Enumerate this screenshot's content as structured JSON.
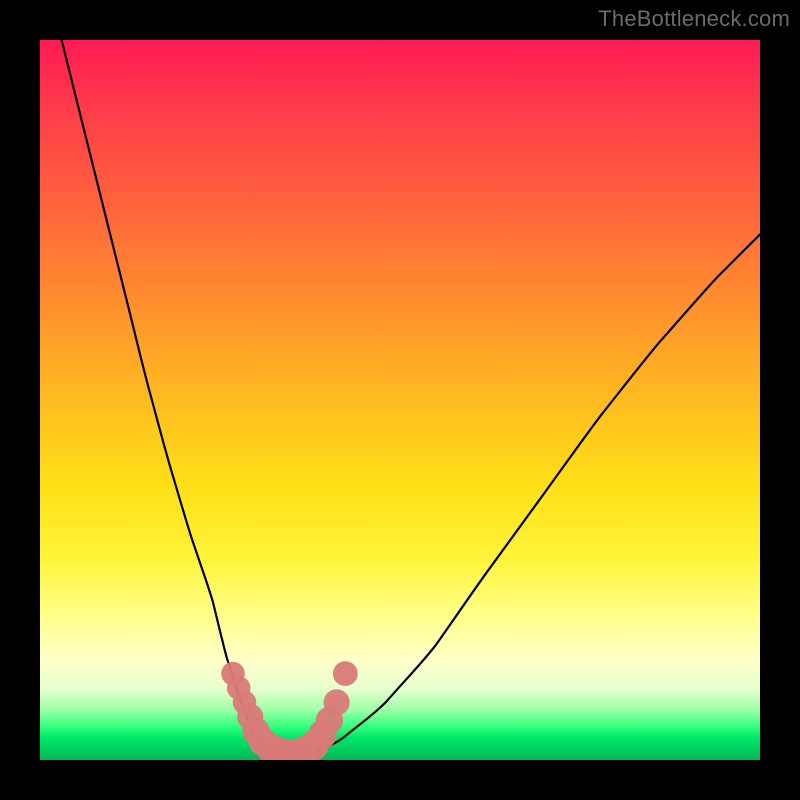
{
  "watermark": "TheBottleneck.com",
  "colors": {
    "frame": "#000000",
    "curve": "#000000",
    "marker": "#d97a78",
    "gradient_top": "#ff1a53",
    "gradient_mid": "#ffe018",
    "gradient_bottom": "#00b955"
  },
  "chart_data": {
    "type": "line",
    "title": "",
    "xlabel": "",
    "ylabel": "",
    "xlim": [
      0,
      100
    ],
    "ylim": [
      0,
      100
    ],
    "grid": false,
    "legend": false,
    "series": [
      {
        "name": "bottleneck-curve",
        "x": [
          3,
          6,
          9,
          12,
          15,
          18,
          21,
          24,
          26,
          28,
          29.5,
          31,
          33,
          35,
          38,
          42,
          48,
          55,
          62,
          70,
          78,
          86,
          94,
          100
        ],
        "y": [
          100,
          88,
          76,
          64,
          52,
          41,
          31,
          22,
          14,
          8,
          4,
          2,
          1,
          0.5,
          1,
          3,
          8,
          16,
          26,
          37,
          48,
          58,
          67,
          73
        ]
      }
    ],
    "markers": [
      {
        "x": 26.8,
        "y": 12,
        "r": 1.2
      },
      {
        "x": 27.6,
        "y": 10,
        "r": 1.2
      },
      {
        "x": 28.4,
        "y": 8,
        "r": 1.2
      },
      {
        "x": 29.2,
        "y": 6,
        "r": 1.4
      },
      {
        "x": 30.0,
        "y": 4,
        "r": 1.5
      },
      {
        "x": 31.0,
        "y": 2.5,
        "r": 1.6
      },
      {
        "x": 32.2,
        "y": 1.5,
        "r": 1.7
      },
      {
        "x": 33.5,
        "y": 1.0,
        "r": 1.7
      },
      {
        "x": 35.0,
        "y": 0.8,
        "r": 1.7
      },
      {
        "x": 36.5,
        "y": 1.2,
        "r": 1.7
      },
      {
        "x": 38.0,
        "y": 2.0,
        "r": 1.7
      },
      {
        "x": 39.2,
        "y": 3.5,
        "r": 1.6
      },
      {
        "x": 40.2,
        "y": 5.5,
        "r": 1.5
      },
      {
        "x": 41.2,
        "y": 8.0,
        "r": 1.4
      },
      {
        "x": 42.4,
        "y": 12,
        "r": 1.3
      }
    ],
    "annotations": []
  }
}
